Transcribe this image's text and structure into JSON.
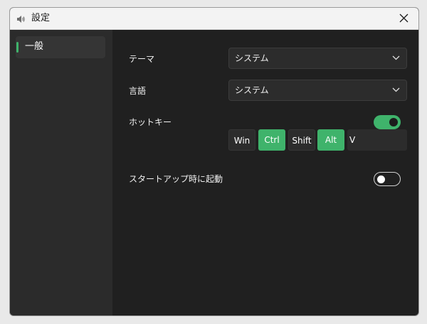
{
  "window": {
    "title": "設定",
    "icon": "speaker-icon"
  },
  "sidebar": {
    "items": [
      {
        "label": "一般",
        "selected": true
      }
    ]
  },
  "settings": {
    "theme": {
      "label": "テーマ",
      "value": "システム"
    },
    "language": {
      "label": "言語",
      "value": "システム"
    },
    "hotkey": {
      "label": "ホットキー",
      "enabled": true,
      "modifiers": [
        {
          "label": "Win",
          "active": false
        },
        {
          "label": "Ctrl",
          "active": true
        },
        {
          "label": "Shift",
          "active": false
        },
        {
          "label": "Alt",
          "active": true
        }
      ],
      "key": "V"
    },
    "startup": {
      "label": "スタートアップ時に起動",
      "enabled": false
    }
  },
  "colors": {
    "accent": "#3fb36b",
    "background": "#202020",
    "sidebar": "#2b2b2b",
    "control": "#2c2c2c"
  }
}
